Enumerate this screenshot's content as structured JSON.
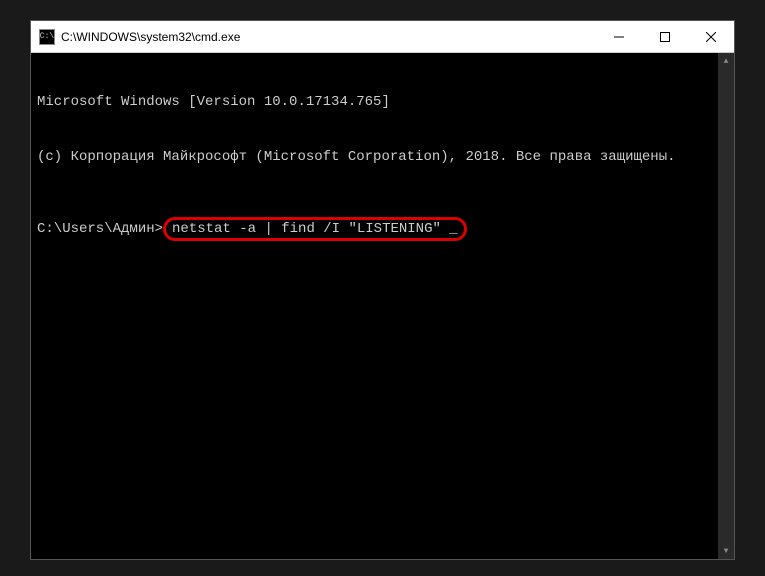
{
  "titlebar": {
    "icon_label": "C:\\",
    "title": "C:\\WINDOWS\\system32\\cmd.exe"
  },
  "terminal": {
    "line1": "Microsoft Windows [Version 10.0.17134.765]",
    "line2": "(c) Корпорация Майкрософт (Microsoft Corporation), 2018. Все права защищены.",
    "prompt": "C:\\Users\\Админ>",
    "command": "netstat -a | find /I \"LISTENING\" _"
  }
}
